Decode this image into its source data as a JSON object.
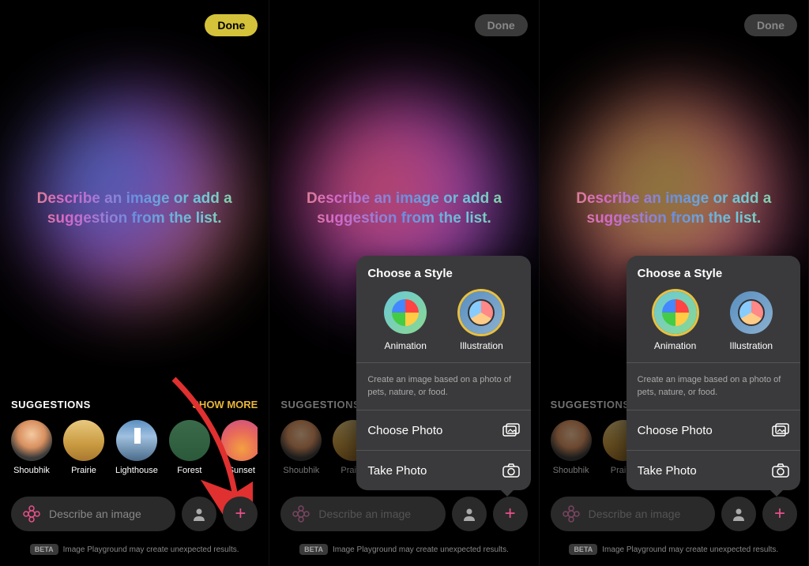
{
  "common": {
    "done_label": "Done",
    "prompt": "Describe an image or add a suggestion from the list.",
    "suggestions_label": "SUGGESTIONS",
    "show_more_label": "SHOW MORE",
    "describe_placeholder": "Describe an image",
    "beta_badge": "BETA",
    "beta_text": "Image Playground may create unexpected results."
  },
  "suggestions": [
    {
      "label": "Shoubhik",
      "style": "sug-person"
    },
    {
      "label": "Prairie",
      "style": "sug-prairie"
    },
    {
      "label": "Lighthouse",
      "style": "sug-lighthouse"
    },
    {
      "label": "Forest",
      "style": "sug-forest"
    },
    {
      "label": "Sunset",
      "style": "sug-sunset"
    }
  ],
  "popover": {
    "title": "Choose a Style",
    "styles": [
      {
        "label": "Animation"
      },
      {
        "label": "Illustration"
      }
    ],
    "help_text": "Create an image based on a photo of pets, nature, or food.",
    "choose_photo_label": "Choose Photo",
    "take_photo_label": "Take Photo"
  },
  "screens": [
    {
      "done_style": "done-active",
      "orb": "orb1",
      "show_arrow": true,
      "show_popover": false,
      "dimmed": false
    },
    {
      "done_style": "done-dim",
      "orb": "orb2",
      "show_arrow": false,
      "show_popover": true,
      "selected_style": 1,
      "dimmed": true
    },
    {
      "done_style": "done-dim",
      "orb": "orb3",
      "show_arrow": false,
      "show_popover": true,
      "selected_style": 0,
      "dimmed": true
    }
  ]
}
